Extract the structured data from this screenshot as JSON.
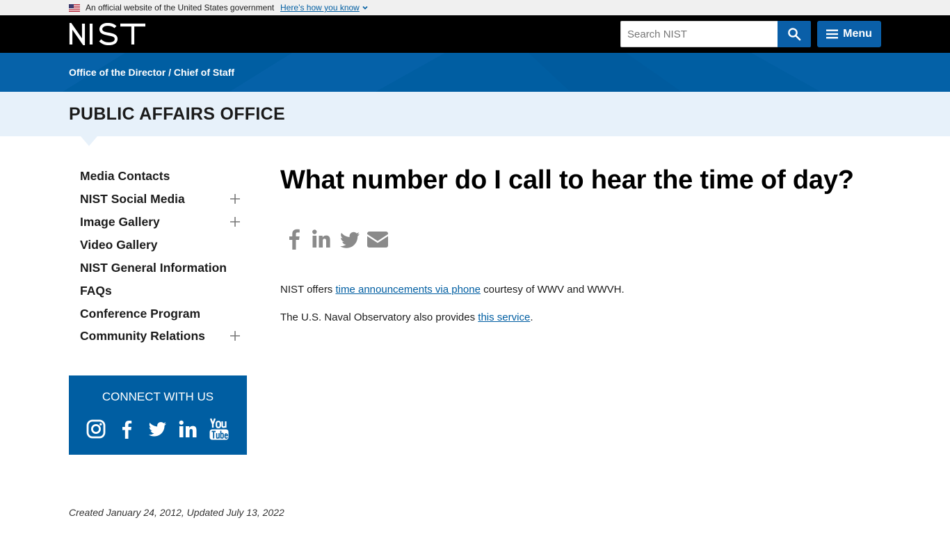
{
  "gov_banner": {
    "official_text": "An official website of the United States government",
    "howto_link": "Here’s how you know"
  },
  "header": {
    "logo_text": "NIST",
    "search": {
      "placeholder": "Search NIST"
    },
    "menu_label": "Menu"
  },
  "org": {
    "breadcrumb": "Office of the Director / Chief of Staff"
  },
  "site": {
    "title": "PUBLIC AFFAIRS OFFICE"
  },
  "sidebar": {
    "items": [
      {
        "label": "Media Contacts",
        "expandable": false
      },
      {
        "label": "NIST Social Media",
        "expandable": true
      },
      {
        "label": "Image Gallery",
        "expandable": true
      },
      {
        "label": "Video Gallery",
        "expandable": false
      },
      {
        "label": "NIST General Information",
        "expandable": false
      },
      {
        "label": "FAQs",
        "expandable": false
      },
      {
        "label": "Conference Program",
        "expandable": false
      },
      {
        "label": "Community Relations",
        "expandable": true
      }
    ]
  },
  "connect": {
    "title": "CONNECT WITH US",
    "icons": [
      "instagram-icon",
      "facebook-icon",
      "twitter-icon",
      "linkedin-icon",
      "youtube-icon"
    ]
  },
  "main": {
    "title": "What number do I call to hear the time of day?",
    "share_icons": [
      "facebook-icon",
      "linkedin-icon",
      "twitter-icon",
      "email-icon"
    ],
    "p1": {
      "before": "NIST offers ",
      "link": "time announcements via phone",
      "after": " courtesy of WWV and WWVH."
    },
    "p2": {
      "before": "The U.S. Naval Observatory also provides ",
      "link": "this service",
      "after": "."
    }
  },
  "footer": {
    "dates": "Created January 24, 2012, Updated July 13, 2022"
  },
  "colors": {
    "header_bg": "#000000",
    "brand_blue": "#005ea2",
    "title_band": "#e7f1fa",
    "link": "#005ea2"
  }
}
